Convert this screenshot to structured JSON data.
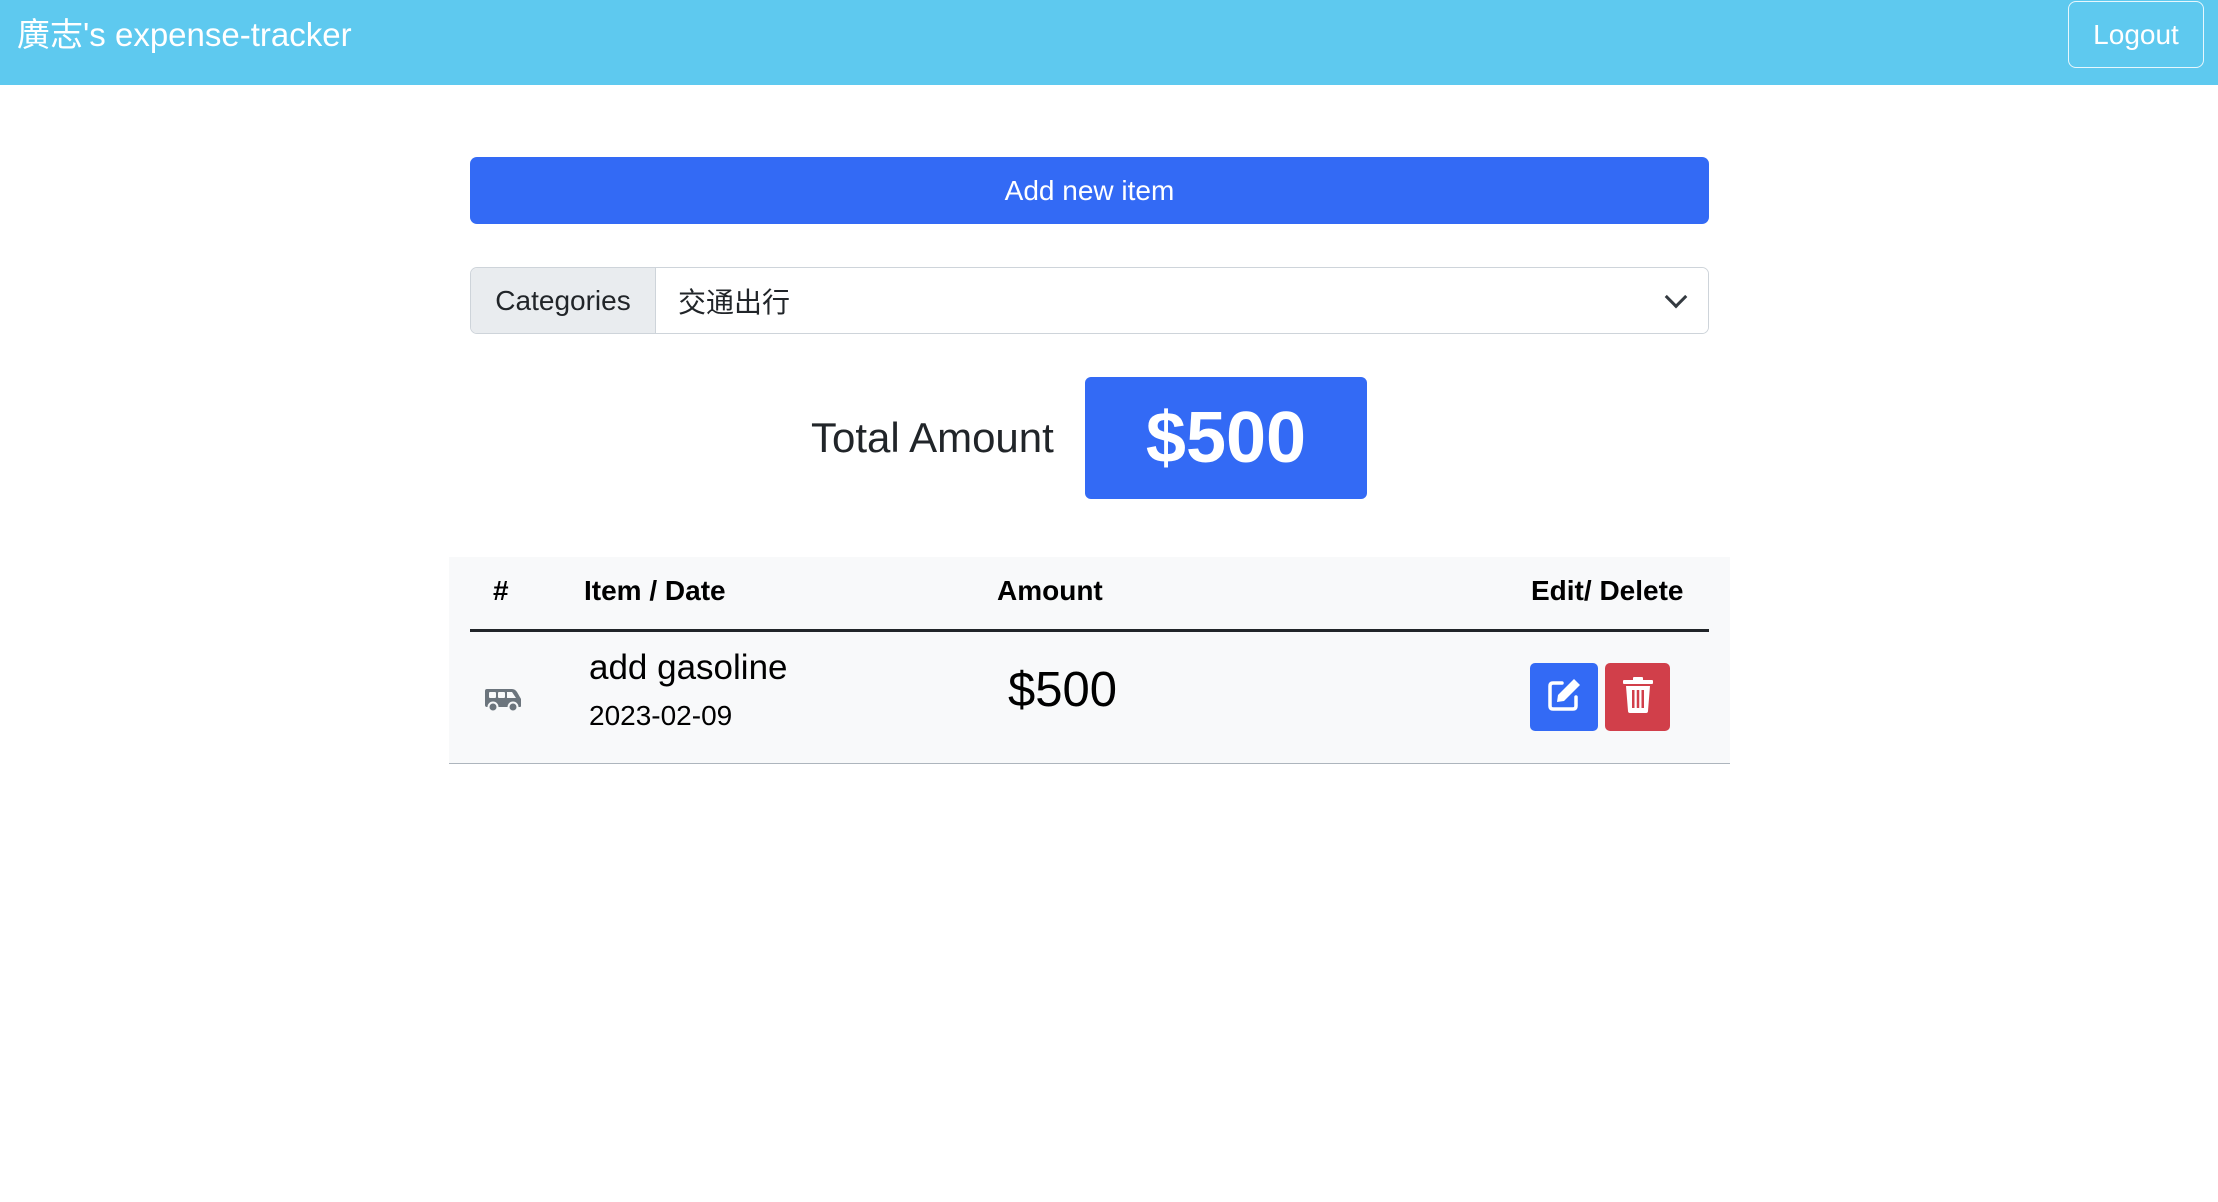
{
  "navbar": {
    "brand": "廣志's expense-tracker",
    "logout_label": "Logout"
  },
  "actions": {
    "add_label": "Add new item"
  },
  "filter": {
    "label": "Categories",
    "selected": "交通出行"
  },
  "summary": {
    "total_label": "Total Amount",
    "total_value": "$500"
  },
  "table": {
    "headers": {
      "index": "#",
      "item_date": "Item / Date",
      "amount": "Amount",
      "edit_delete": "Edit/ Delete"
    },
    "rows": [
      {
        "category_icon": "van-icon",
        "name": "add gasoline",
        "date": "2023-02-09",
        "amount": "$500"
      }
    ]
  },
  "colors": {
    "navbar": "#5ec9ef",
    "primary": "#336af5",
    "danger": "#d13f4a"
  }
}
